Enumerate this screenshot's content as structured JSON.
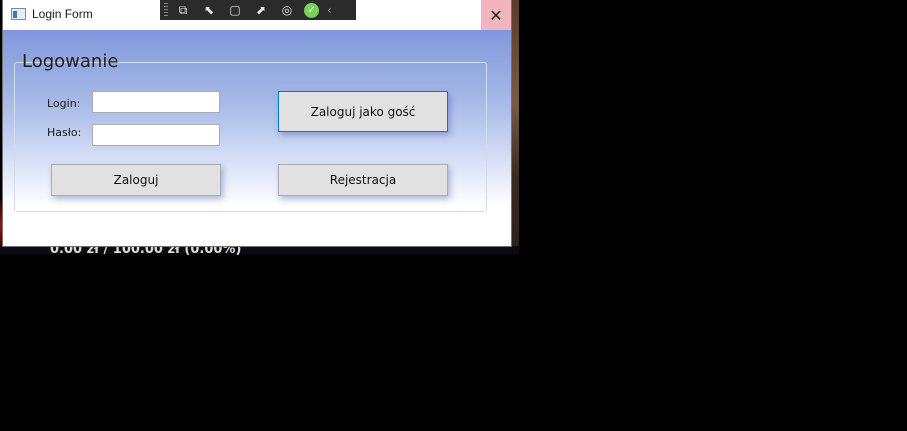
{
  "window": {
    "title": "Login Form",
    "close_glyph": "✕",
    "icon": "app-window-icon"
  },
  "debug_toolbar": {
    "buttons": [
      {
        "icon": "go-to-live-visual-tree-icon",
        "glyph": "⧉"
      },
      {
        "icon": "select-element-icon",
        "glyph": "⬉"
      },
      {
        "icon": "display-layout-adorners-icon",
        "glyph": "▢"
      },
      {
        "icon": "track-focused-element-icon",
        "glyph": "⬈"
      },
      {
        "icon": "hot-reload-icon",
        "glyph": "◎"
      }
    ],
    "check_glyph": "✓",
    "collapse_glyph": "‹"
  },
  "form": {
    "group_title": "Logowanie",
    "login_label": "Login:",
    "login_value": "",
    "password_label": "Hasło:",
    "password_value": "",
    "guest_button": "Zaloguj jako gość",
    "login_button": "Zaloguj",
    "register_button": "Rejestracja"
  },
  "background": {
    "status_text": "0.00 zł / 100.00 zł (0.00%)"
  },
  "colors": {
    "gradient_top": "#7f98dc",
    "close_hover": "#f1b6bd",
    "accent_border": "#0078d7",
    "button_face": "#e1e1e1"
  }
}
